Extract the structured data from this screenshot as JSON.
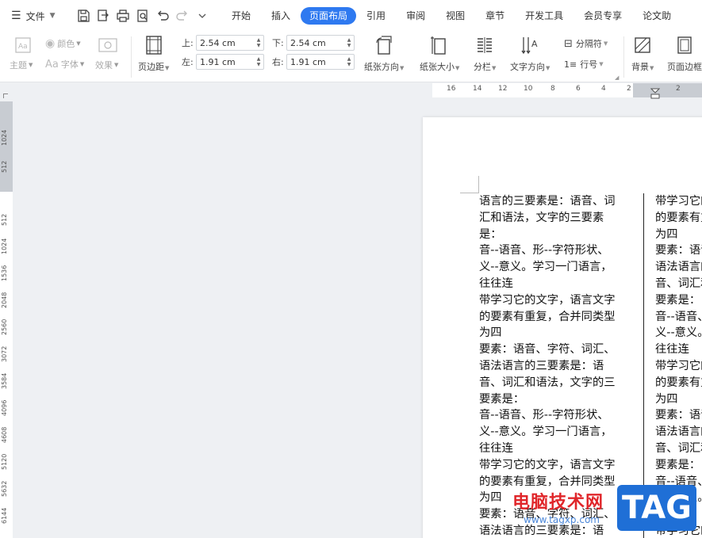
{
  "app": {
    "menu_label": "文件"
  },
  "tabs": [
    "开始",
    "插入",
    "页面布局",
    "引用",
    "审阅",
    "视图",
    "章节",
    "开发工具",
    "会员专享",
    "论文助"
  ],
  "active_tab": "页面布局",
  "ribbon": {
    "theme": "主题",
    "color": "颜色",
    "font": "字体",
    "effect": "效果",
    "margins": "页边距",
    "top_label": "上:",
    "top_value": "2.54 cm",
    "bottom_label": "下:",
    "bottom_value": "2.54 cm",
    "left_label": "左:",
    "left_value": "1.91 cm",
    "right_label": "右:",
    "right_value": "1.91 cm",
    "orientation": "纸张方向",
    "size": "纸张大小",
    "columns": "分栏",
    "text_direction": "文字方向",
    "breaks": "分隔符",
    "line_numbers": "行号",
    "background": "背景",
    "page_border": "页面边框"
  },
  "ruler": {
    "h_numbers": [
      "16",
      "14",
      "12",
      "10",
      "8",
      "6",
      "4",
      "2",
      "2"
    ],
    "v_numbers": [
      "1024",
      "512",
      "512",
      "1024",
      "1536",
      "2048",
      "2560",
      "3072",
      "3584",
      "4096",
      "4608",
      "5120",
      "5632",
      "6144"
    ]
  },
  "document": {
    "col1_lines": [
      "语言的三要素是：语音、词",
      "汇和语法，文字的三要素",
      "是：",
      "音--语音、形--字符形状、",
      "义--意义。学习一门语言，",
      "往往连",
      "带学习它的文字，语言文字",
      "的要素有重复，合并同类型",
      "为四",
      "要素：语音、字符、词汇、",
      "语法语言的三要素是：语",
      "音、词汇和语法，文字的三",
      "要素是：",
      "音--语音、形--字符形状、",
      "义--意义。学习一门语言，",
      "往往连",
      "带学习它的文字，语言文字",
      "的要素有重复，合并同类型",
      "为四",
      "要素：语音、字符、词汇、",
      "语法语言的三要素是：语"
    ],
    "col2_lines": [
      "带学习它的文字",
      "的要素有重复",
      "为四",
      "要素：语音、",
      "语法语言的三",
      "音、词汇和语",
      "要素是：",
      "音--语音、形",
      "义--意义。学",
      "往往连",
      "带学习它的文",
      "的要素有重复",
      "为四",
      "要素：语音、",
      "语法语言的三",
      "音、词汇和语",
      "要素是：",
      "音--语音、形",
      "义--意义。学",
      "往往连",
      "带学习它的文"
    ]
  },
  "watermark": {
    "site_name": "电脑技术网",
    "url": "www.tagxp.com",
    "badge": "TAG"
  },
  "colors": {
    "accent": "#2e79f0",
    "watermark_red": "#e0262a",
    "badge_blue": "#1f6fd6"
  }
}
